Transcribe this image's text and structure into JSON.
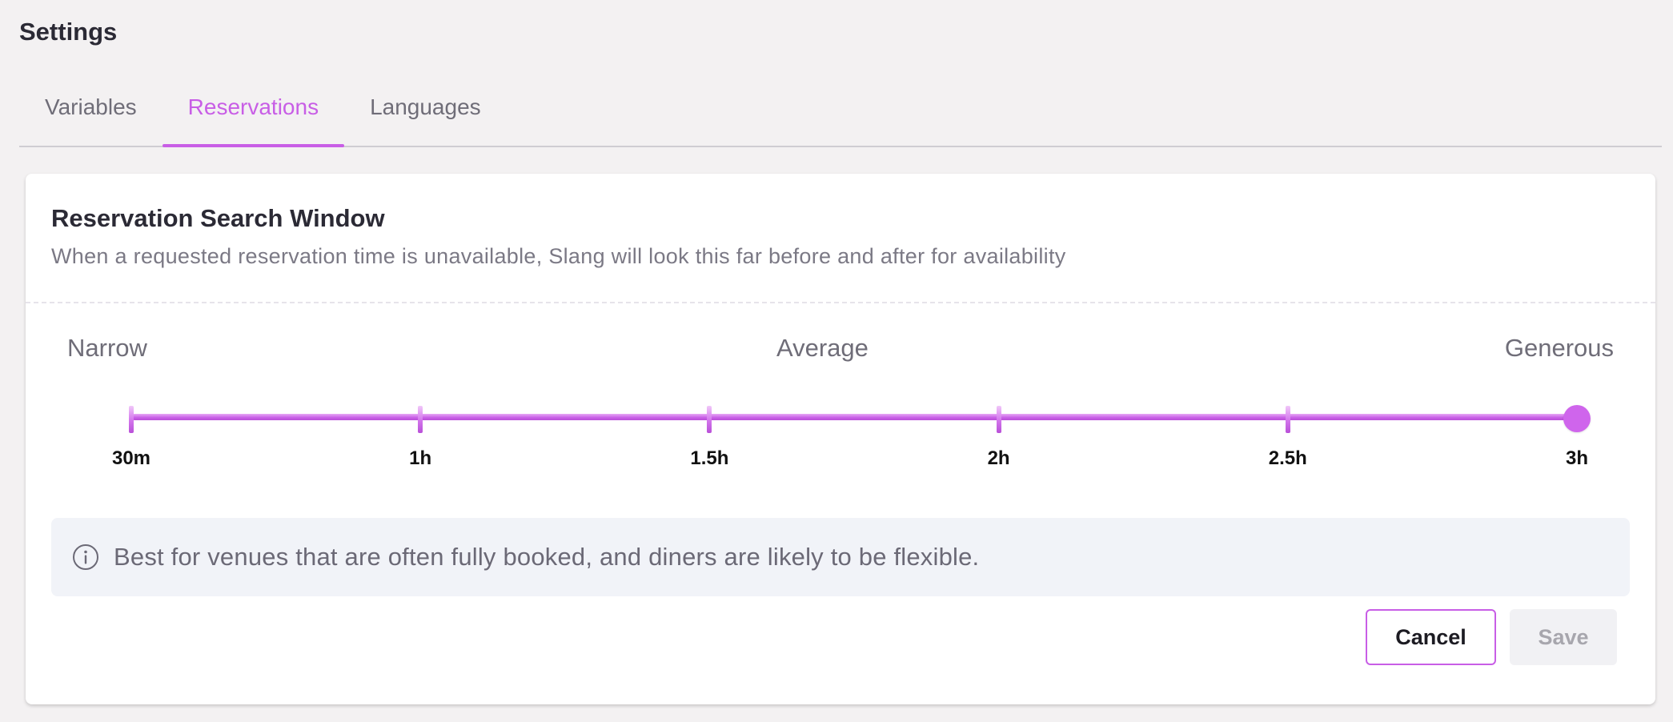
{
  "page": {
    "title": "Settings"
  },
  "tabs": [
    {
      "label": "Variables",
      "active": false
    },
    {
      "label": "Reservations",
      "active": true
    },
    {
      "label": "Languages",
      "active": false
    }
  ],
  "colors": {
    "accent": "#c85ee6",
    "background": "#f3f1f2",
    "card": "#ffffff",
    "info_box": "#f1f3f8"
  },
  "card": {
    "title": "Reservation Search Window",
    "description": "When a requested reservation time is unavailable, Slang will look this far before and after for availability",
    "scale": {
      "narrow_label": "Narrow",
      "average_label": "Average",
      "generous_label": "Generous"
    },
    "slider": {
      "ticks": [
        "30m",
        "1h",
        "1.5h",
        "2h",
        "2.5h",
        "3h"
      ],
      "selected_value": "3h",
      "selected_index": 5
    },
    "info": {
      "icon": "info-circle-icon",
      "text": "Best for venues that are often fully booked, and diners are likely to be flexible."
    },
    "actions": {
      "cancel_label": "Cancel",
      "save_label": "Save",
      "save_disabled": true
    }
  }
}
